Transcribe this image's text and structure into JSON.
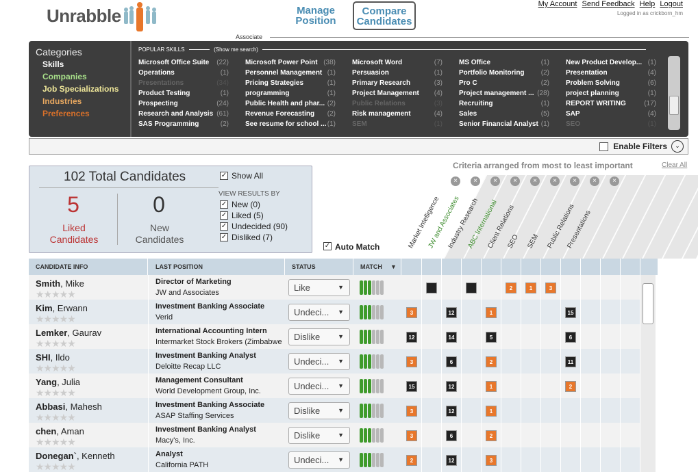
{
  "app": {
    "name": "Unrabble"
  },
  "tabs": [
    {
      "label": "Manage\nPosition"
    },
    {
      "label": "Compare\nCandidates"
    }
  ],
  "toplinks": [
    "My Account",
    "Send Feedback",
    "Help",
    "Logout"
  ],
  "logged_in": "Logged in as crickborn_hm",
  "position_label": "Associate",
  "categories": {
    "title": "Categories",
    "items": [
      {
        "label": "Skills",
        "color": "#ffffff"
      },
      {
        "label": "Companies",
        "color": "#a8e08a"
      },
      {
        "label": "Job Specializations",
        "color": "#f0e89a"
      },
      {
        "label": "Industries",
        "color": "#e8a860"
      },
      {
        "label": "Preferences",
        "color": "#d8702a"
      }
    ]
  },
  "popular_skills": {
    "heading": "POPULAR SKILLS",
    "show_search": "(Show me search)",
    "columns": [
      [
        [
          "Microsoft Office Suite",
          "(22)",
          0
        ],
        [
          "Operations",
          "(1)",
          0
        ],
        [
          "Presentations",
          "(34)",
          1
        ],
        [
          "Product Testing",
          "(1)",
          0
        ],
        [
          "Prospecting",
          "(24)",
          0
        ],
        [
          "Research and Analysis",
          "(61)",
          0
        ],
        [
          "SAS Programming",
          "(2)",
          0
        ]
      ],
      [
        [
          "Microsoft Power Point",
          "(38)",
          0
        ],
        [
          "Personnel Management",
          "(1)",
          0
        ],
        [
          "Pricing Strategies",
          "(1)",
          0
        ],
        [
          "programming",
          "(1)",
          0
        ],
        [
          "Public Health and phar...",
          "(2)",
          0
        ],
        [
          "Revenue Forecasting",
          "(2)",
          0
        ],
        [
          "See resume for school ...",
          "(1)",
          0
        ]
      ],
      [
        [
          "Microsoft Word",
          "(7)",
          0
        ],
        [
          "Persuasion",
          "(1)",
          0
        ],
        [
          "Primary Research",
          "(3)",
          0
        ],
        [
          "Project Management",
          "(4)",
          0
        ],
        [
          "Public Relations",
          "(3)",
          1
        ],
        [
          "Risk management",
          "(4)",
          0
        ],
        [
          "SEM",
          "(1)",
          1
        ]
      ],
      [
        [
          "MS Office",
          "(1)",
          0
        ],
        [
          "Portfolio Monitoring",
          "(2)",
          0
        ],
        [
          "Pro C",
          "(2)",
          0
        ],
        [
          "Project management ...",
          "(28)",
          0
        ],
        [
          "Recruiting",
          "(1)",
          0
        ],
        [
          "Sales",
          "(5)",
          0
        ],
        [
          "Senior Financial Analyst",
          "(1)",
          0
        ]
      ],
      [
        [
          "New Product Develop...",
          "(1)",
          0
        ],
        [
          "Presentation",
          "(4)",
          0
        ],
        [
          "Problem Solving",
          "(6)",
          0
        ],
        [
          "project planning",
          "(1)",
          0
        ],
        [
          "REPORT WRITING",
          "(17)",
          0
        ],
        [
          "SAP",
          "(4)",
          0
        ],
        [
          "SEO",
          "(1)",
          1
        ]
      ]
    ]
  },
  "filters": {
    "enable_label": "Enable Filters"
  },
  "summary": {
    "total": "102 Total Candidates",
    "liked_num": "5",
    "liked_label": "Liked\nCandidates",
    "new_num": "0",
    "new_label": "New\nCandidates",
    "show_all": "Show All",
    "view_by": "VIEW RESULTS BY",
    "options": [
      "New (0)",
      "Liked (5)",
      "Undecided (90)",
      "Disliked (7)"
    ]
  },
  "auto_match": "Auto Match",
  "criteria_note": "Criteria arranged from most to least important",
  "clear_all": "Clear All",
  "criteria": [
    {
      "label": "Market Intelligence",
      "color": "#333333"
    },
    {
      "label": "JW and Associates",
      "color": "#3a8a2a"
    },
    {
      "label": "Industry Research",
      "color": "#333333"
    },
    {
      "label": "ABC International",
      "color": "#3a8a2a"
    },
    {
      "label": "Client Relations",
      "color": "#333333"
    },
    {
      "label": "SEO",
      "color": "#333333"
    },
    {
      "label": "SEM",
      "color": "#333333"
    },
    {
      "label": "Public Relations",
      "color": "#333333"
    },
    {
      "label": "Presentations",
      "color": "#333333"
    }
  ],
  "table": {
    "headers": [
      "CANDIDATE INFO",
      "LAST POSITION",
      "STATUS",
      "MATCH"
    ],
    "rows": [
      {
        "last": "Smith",
        "first": ", Mike",
        "title": "Director of Marketing",
        "company": "JW and Associates",
        "status": "Like",
        "match": 3,
        "badges": [
          [
            1,
            "k",
            ""
          ],
          [
            3,
            "k",
            ""
          ],
          [
            5,
            "o",
            "2"
          ],
          [
            6,
            "o",
            "1"
          ],
          [
            7,
            "o",
            "3"
          ]
        ]
      },
      {
        "last": "Kim",
        "first": ", Erwann",
        "title": "Investment Banking Associate",
        "company": "Verid",
        "status": "Undeci...",
        "match": 3,
        "badges": [
          [
            0,
            "o",
            "3"
          ],
          [
            2,
            "k",
            "12"
          ],
          [
            4,
            "o",
            "1"
          ],
          [
            8,
            "k",
            "15"
          ]
        ]
      },
      {
        "last": "Lemker",
        "first": ", Gaurav",
        "title": "International Accounting Intern",
        "company": "Intermarket Stock Brokers (Zimbabwe",
        "status": "Dislike",
        "match": 3,
        "badges": [
          [
            0,
            "k",
            "12"
          ],
          [
            2,
            "k",
            "14"
          ],
          [
            4,
            "k",
            "5"
          ],
          [
            8,
            "k",
            "6"
          ]
        ]
      },
      {
        "last": "SHI",
        "first": ", Ildo",
        "title": "Investment Banking Analyst",
        "company": "Deloitte Recap LLC",
        "status": "Undeci...",
        "match": 3,
        "badges": [
          [
            0,
            "o",
            "3"
          ],
          [
            2,
            "k",
            "6"
          ],
          [
            4,
            "o",
            "2"
          ],
          [
            8,
            "k",
            "11"
          ]
        ]
      },
      {
        "last": "Yang",
        "first": ", Julia",
        "title": "Management Consultant",
        "company": "World Development Group, Inc.",
        "status": "Undeci...",
        "match": 3,
        "badges": [
          [
            0,
            "k",
            "15"
          ],
          [
            2,
            "k",
            "12"
          ],
          [
            4,
            "o",
            "1"
          ],
          [
            8,
            "o",
            "2"
          ]
        ]
      },
      {
        "last": "Abbasi",
        "first": ", Mahesh",
        "title": "Investment Banking Associate",
        "company": "ASAP Staffing Services",
        "status": "Dislike",
        "match": 3,
        "badges": [
          [
            0,
            "o",
            "3"
          ],
          [
            2,
            "k",
            "12"
          ],
          [
            4,
            "o",
            "1"
          ]
        ]
      },
      {
        "last": "chen",
        "first": ", Aman",
        "title": "Investment Banking Analyst",
        "company": "Macy's, Inc.",
        "status": "Dislike",
        "match": 3,
        "badges": [
          [
            0,
            "o",
            "3"
          ],
          [
            2,
            "k",
            "6"
          ],
          [
            4,
            "o",
            "2"
          ]
        ]
      },
      {
        "last": "Donegan`",
        "first": ", Kenneth",
        "title": "Analyst",
        "company": "California PATH",
        "status": "Undeci...",
        "match": 3,
        "badges": [
          [
            0,
            "o",
            "2"
          ],
          [
            2,
            "k",
            "12"
          ],
          [
            4,
            "o",
            "3"
          ]
        ]
      }
    ]
  }
}
